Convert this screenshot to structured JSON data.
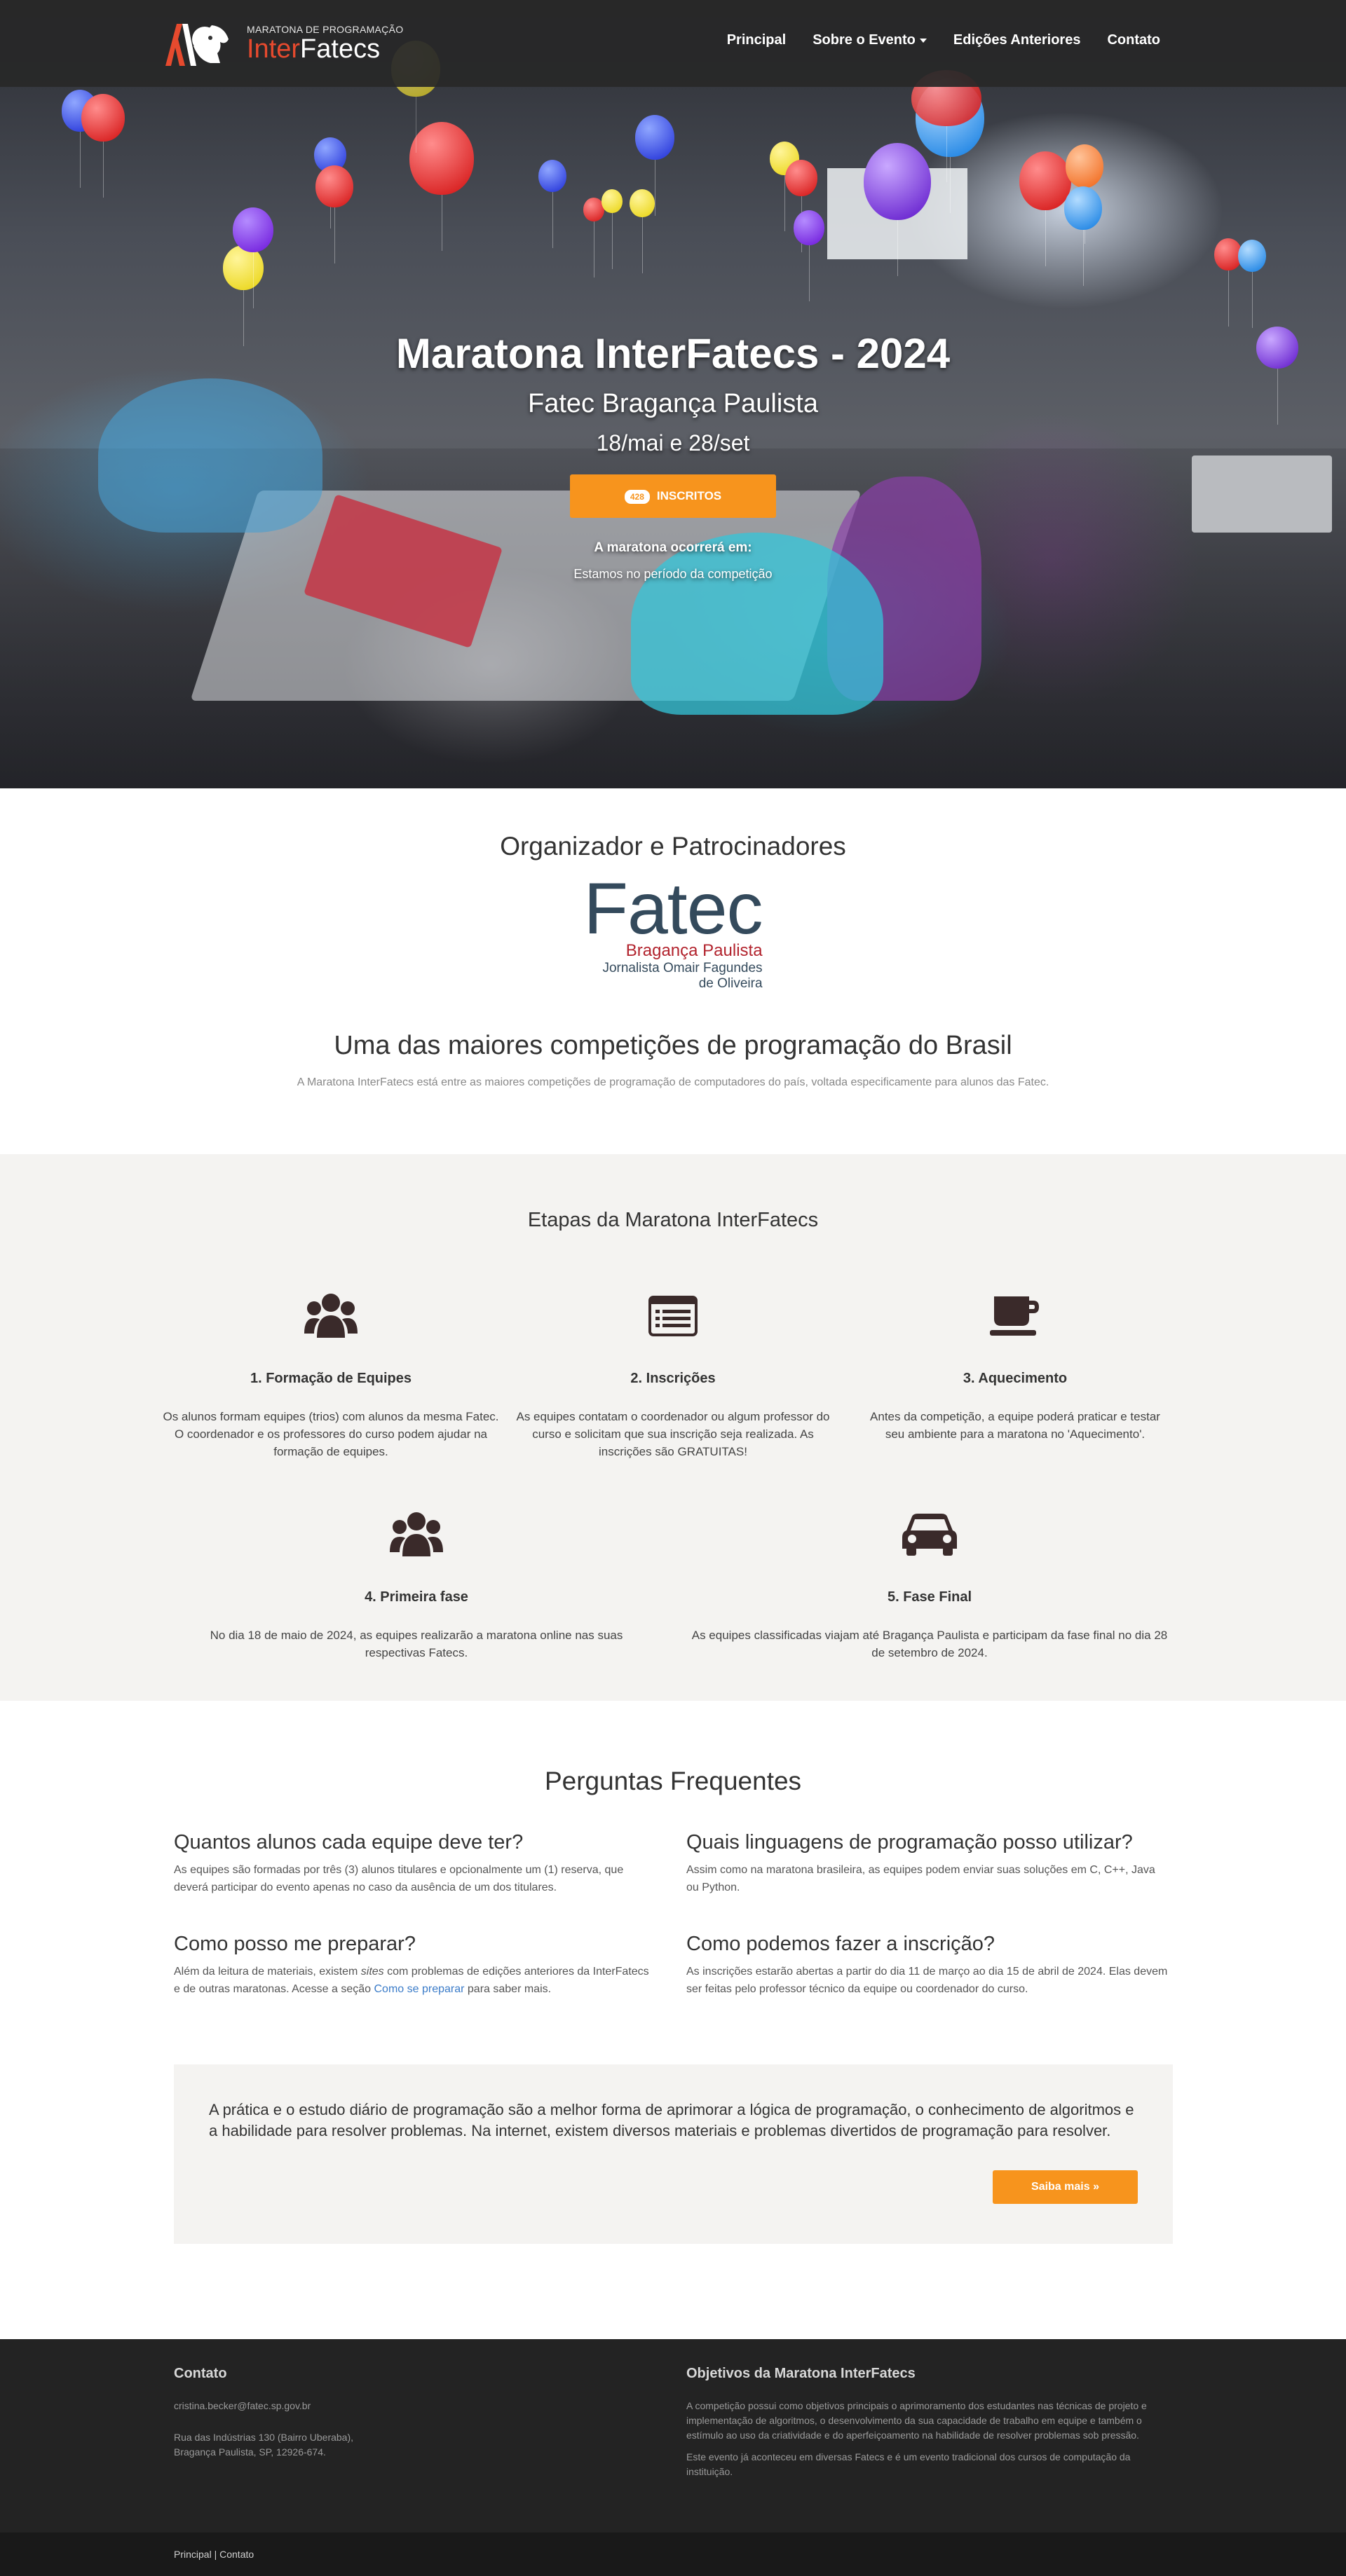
{
  "brand": {
    "small": "MARATONA DE PROGRAMAÇÃO",
    "inter": "Inter",
    "fatecs": "Fatecs"
  },
  "nav": {
    "principal": "Principal",
    "sobre": "Sobre o Evento",
    "edicoes": "Edições Anteriores",
    "contato": "Contato"
  },
  "hero": {
    "title": "Maratona InterFatecs - 2024",
    "subtitle": "Fatec Bragança Paulista",
    "dates": "18/mai e 28/set",
    "count": "428",
    "inscritos": "INSCRITOS",
    "occurrence": "A maratona ocorrerá em:",
    "status": "Estamos no período da competição"
  },
  "sponsors": {
    "heading": "Organizador e Patrocinadores",
    "logo_word": "Fatec",
    "logo_city": "Bragança Paulista",
    "logo_name1": "Jornalista Omair Fagundes",
    "logo_name2": "de Oliveira",
    "tag_heading": "Uma das maiores competições de programação do Brasil",
    "tag_text": "A Maratona InterFatecs está entre as maiores competições de programação de computadores do país, voltada especificamente para alunos das Fatec."
  },
  "etapas": {
    "heading": "Etapas da Maratona InterFatecs",
    "steps": [
      {
        "title": "1. Formação de Equipes",
        "text": "Os alunos formam equipes (trios) com alunos da mesma Fatec. O coordenador e os professores do curso podem ajudar na formação de equipes.",
        "icon": "users-icon"
      },
      {
        "title": "2. Inscrições",
        "text": "As equipes contatam o coordenador ou algum professor do curso e solicitam que sua inscrição seja realizada. As inscrições são GRATUITAS!",
        "icon": "list-icon"
      },
      {
        "title": "3. Aquecimento",
        "text": "Antes da competição, a equipe poderá praticar e testar seu ambiente para a maratona no 'Aquecimento'.",
        "icon": "coffee-icon"
      },
      {
        "title": "4. Primeira fase",
        "text": "No dia 18 de maio de 2024, as equipes realizarão a maratona online nas suas respectivas Fatecs.",
        "icon": "users-icon"
      },
      {
        "title": "5. Fase Final",
        "text": "As equipes classificadas viajam até Bragança Paulista e participam da fase final no dia 28 de setembro de 2024.",
        "icon": "car-icon"
      }
    ]
  },
  "faq": {
    "heading": "Perguntas Frequentes",
    "items": [
      {
        "q": "Quantos alunos cada equipe deve ter?",
        "a": "As equipes são formadas por três (3) alunos titulares e opcionalmente um (1) reserva, que deverá participar do evento apenas no caso da ausência de um dos titulares."
      },
      {
        "q": "Quais linguagens de programação posso utilizar?",
        "a": "Assim como na maratona brasileira, as equipes podem enviar suas soluções em C, C++, Java ou Python."
      },
      {
        "q": "Como posso me preparar?",
        "a_pre": "Além da leitura de materiais, existem ",
        "a_em": "sites",
        "a_mid": " com problemas de edições anteriores da InterFatecs e de outras maratonas. Acesse a seção ",
        "a_link": "Como se preparar",
        "a_post": " para saber mais."
      },
      {
        "q": "Como podemos fazer a inscrição?",
        "a": "As inscrições estarão abertas a partir do dia 11 de março ao dia 15 de abril de 2024. Elas devem ser feitas pelo professor técnico da equipe ou coordenador do curso."
      }
    ],
    "jumbo_text": "A prática e o estudo diário de programação são a melhor forma de aprimorar a lógica de programação, o conhecimento de algoritmos e a habilidade para resolver problemas. Na internet, existem diversos materiais e problemas divertidos de programação para resolver.",
    "jumbo_button": "Saiba mais »"
  },
  "footer": {
    "contact_heading": "Contato",
    "email": "cristina.becker@fatec.sp.gov.br",
    "address1": "Rua das Indústrias 130 (Bairro Uberaba),",
    "address2": "Bragança Paulista, SP, 12926-674.",
    "goals_heading": "Objetivos da Maratona InterFatecs",
    "goals_p1": "A competição possui como objetivos principais o aprimoramento dos estudantes nas técnicas de projeto e implementação de algoritmos, o desenvolvimento da sua capacidade de trabalho em equipe e também o estímulo ao uso da criatividade e do aperfeiçoamento na habilidade de resolver problemas sob pressão.",
    "goals_p2": "Este evento já aconteceu em diversas Fatecs e é um evento tradicional dos cursos de computação da instituição.",
    "link_principal": "Principal",
    "separator": " | ",
    "link_contato": "Contato"
  },
  "colors": {
    "accent": "#f7941d",
    "brand_red": "#e64a2e",
    "dark": "#232323",
    "fatec_blue": "#344a5c"
  }
}
